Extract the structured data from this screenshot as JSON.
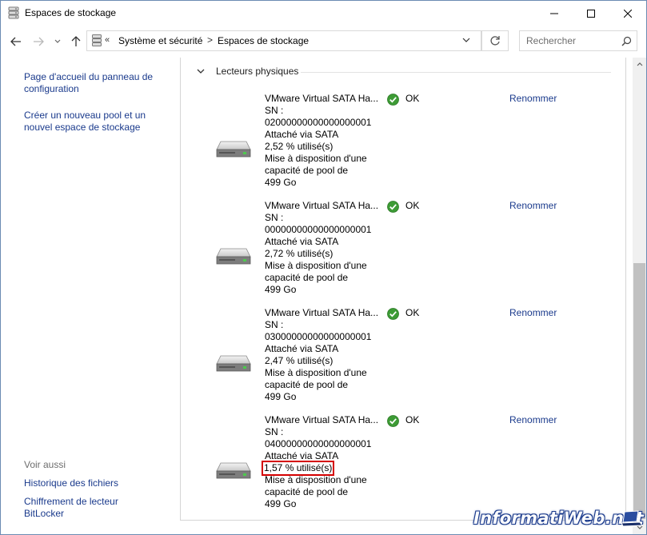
{
  "window": {
    "title": "Espaces de stockage",
    "icon": "storage-spaces-icon"
  },
  "address": {
    "prefix": "«",
    "crumbs": [
      "Système et sécurité",
      "Espaces de stockage"
    ],
    "separator": ">",
    "search_placeholder": "Rechercher"
  },
  "sidebar": {
    "links": [
      "Page d'accueil du panneau de configuration",
      "Créer un nouveau pool et un nouvel espace de stockage"
    ],
    "see_also_title": "Voir aussi",
    "see_also": [
      "Historique des fichiers",
      "Chiffrement de lecteur BitLocker"
    ]
  },
  "section": {
    "title": "Lecteurs physiques"
  },
  "drives": [
    {
      "name": "VMware Virtual SATA Ha...",
      "sn_label": "SN :",
      "sn": "02000000000000000001",
      "attached": "Attaché via SATA",
      "usage": "2,52 % utilisé(s)",
      "capacity_lines": [
        "Mise à disposition d'une",
        "capacité de pool de",
        "499 Go"
      ],
      "status": "OK",
      "rename": "Renommer"
    },
    {
      "name": "VMware Virtual SATA Ha...",
      "sn_label": "SN :",
      "sn": "00000000000000000001",
      "attached": "Attaché via SATA",
      "usage": "2,72 % utilisé(s)",
      "capacity_lines": [
        "Mise à disposition d'une",
        "capacité de pool de",
        "499 Go"
      ],
      "status": "OK",
      "rename": "Renommer"
    },
    {
      "name": "VMware Virtual SATA Ha...",
      "sn_label": "SN :",
      "sn": "03000000000000000001",
      "attached": "Attaché via SATA",
      "usage": "2,47 % utilisé(s)",
      "capacity_lines": [
        "Mise à disposition d'une",
        "capacité de pool de",
        "499 Go"
      ],
      "status": "OK",
      "rename": "Renommer"
    },
    {
      "name": "VMware Virtual SATA Ha...",
      "sn_label": "SN :",
      "sn": "04000000000000000001",
      "attached": "Attaché via SATA",
      "usage": "1,57 % utilisé(s)",
      "capacity_lines": [
        "Mise à disposition d'une",
        "capacité de pool de",
        "499 Go"
      ],
      "status": "OK",
      "rename": "Renommer"
    }
  ],
  "watermark": "InformatiWeb.net",
  "colors": {
    "link": "#1a3a8c",
    "ok_green": "#3d9b35",
    "highlight_red": "#d40000"
  }
}
